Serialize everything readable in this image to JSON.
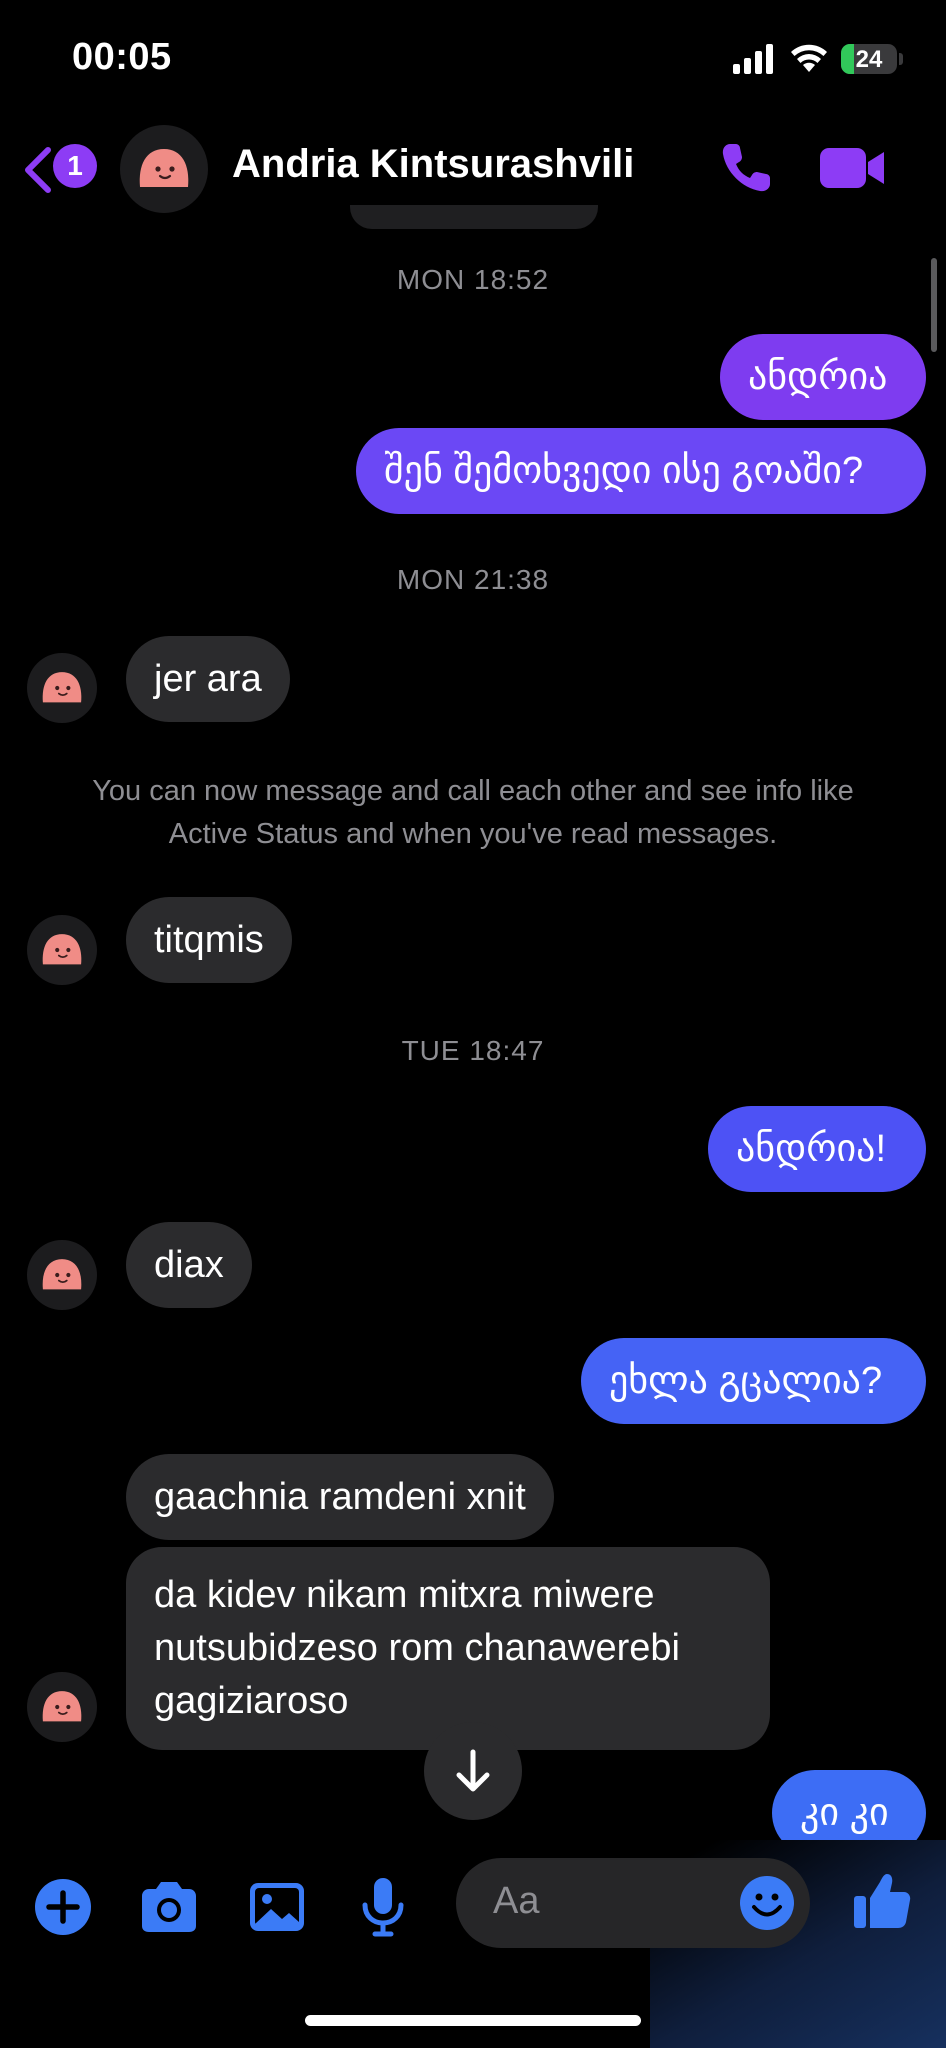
{
  "status_bar": {
    "time": "00:05",
    "battery_level": "24",
    "battery_fraction": 0.24,
    "battery_color": "#31c85a"
  },
  "header": {
    "back_badge_count": "1",
    "contact_name": "Andria Kintsurashvili",
    "accent_color": "#8d3cf5",
    "icons": [
      "chevron-left-icon",
      "phone-icon",
      "video-camera-icon"
    ]
  },
  "conversation": {
    "timestamps": {
      "mon_1852": "MON 18:52",
      "mon_2138": "MON 21:38",
      "tue_1847": "TUE 18:47"
    },
    "messages": [
      {
        "from": "me",
        "text": "ანდრია"
      },
      {
        "from": "me",
        "text": "შენ შემოხვედი ისე გოაში?"
      },
      {
        "from": "them",
        "text": "jer ara"
      },
      {
        "from": "them",
        "text": "titqmis"
      },
      {
        "from": "me",
        "text": "ანდრია!"
      },
      {
        "from": "them",
        "text": "diax"
      },
      {
        "from": "me",
        "text": "ეხლა გცალია?"
      },
      {
        "from": "them",
        "text": "gaachnia ramdeni xnit"
      },
      {
        "from": "them",
        "text": "da kidev nikam mitxra miwere nutsubidzeso rom chanawerebi gagiziaroso"
      },
      {
        "from": "me",
        "text": "კი კი"
      }
    ],
    "system_message": "You can now message and call each other and see info like Active Status and when you've read messages.",
    "bubble_colors": [
      "#7e3cf0",
      "#6b48f5",
      "#4d52f5",
      "#4563f5",
      "#3d6df5"
    ]
  },
  "composer": {
    "placeholder": "Aa",
    "icons": [
      "plus-circle-icon",
      "camera-icon",
      "photo-icon",
      "microphone-icon",
      "emoji-icon",
      "thumbs-up-icon"
    ],
    "accent_color": "#3b7bf6"
  }
}
